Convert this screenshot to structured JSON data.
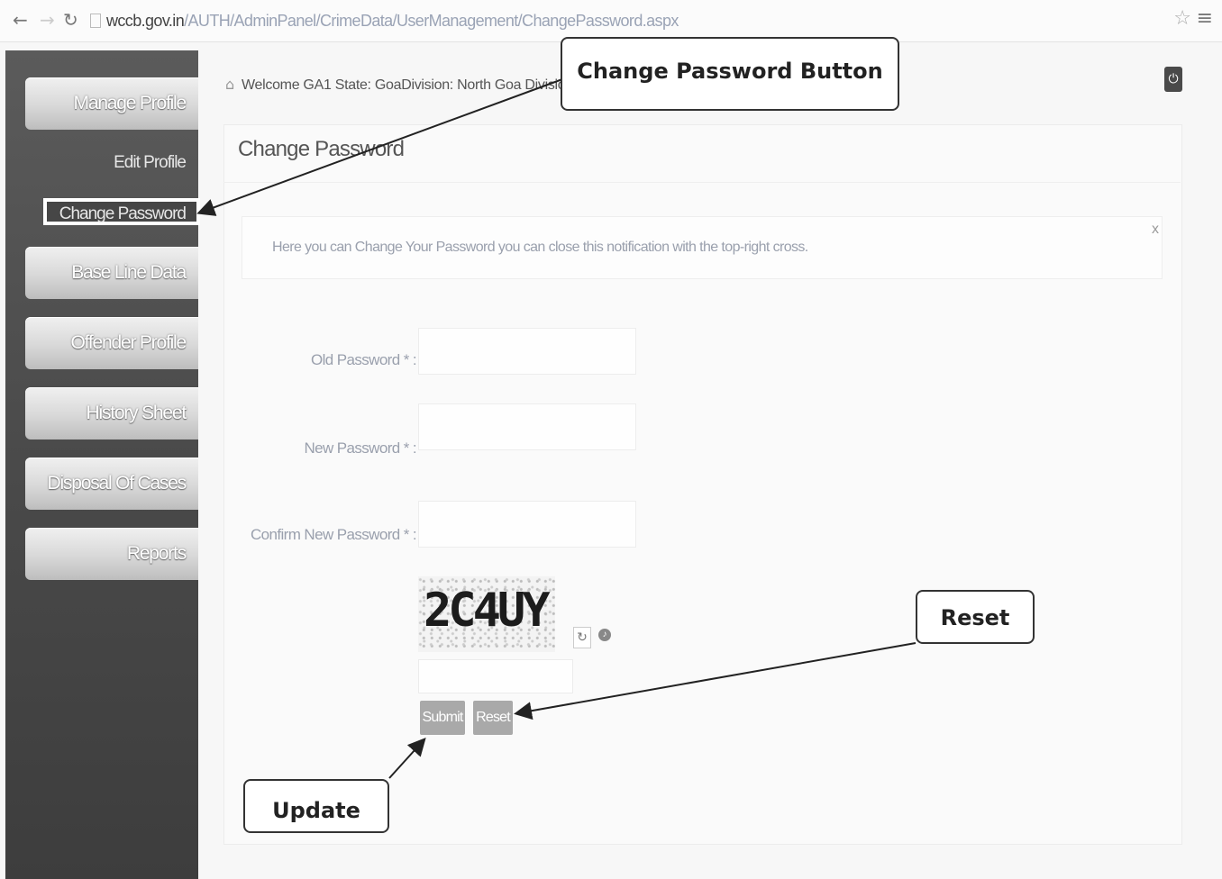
{
  "browser": {
    "back_icon": "arrow-left-icon",
    "forward_icon": "arrow-right-icon",
    "reload_icon": "reload-icon",
    "url_host": "wccb.gov.in",
    "url_path": "/AUTH/AdminPanel/CrimeData/UserManagement/ChangePassword.aspx"
  },
  "sidebar": {
    "manage_profile": "Manage Profile",
    "edit_profile": "Edit Profile",
    "change_password": "Change Password",
    "base_line_data": "Base Line Data",
    "offender_profile": "Offender Profile",
    "history_sheet": "History Sheet",
    "disposal_of_cases": "Disposal Of Cases",
    "reports": "Reports"
  },
  "header": {
    "welcome": "Welcome GA1 State: GoaDivision: North Goa Division"
  },
  "panel": {
    "title": "Change Password",
    "notice": "Here you can Change Your Password you can close this notification with the top-right cross.",
    "close_glyph": "x"
  },
  "form": {
    "old_password_label": "Old Password * :",
    "new_password_label": "New Password * :",
    "confirm_password_label": "Confirm New Password * :",
    "captcha_text": "2C4UY",
    "submit_label": "Submit",
    "reset_label": "Reset"
  },
  "callouts": {
    "change_password_button": "Change Password Button",
    "reset": "Reset",
    "update": "Update"
  },
  "colors": {
    "sidebar_bg": "#4a4a4a",
    "button_gray": "#a9a9a9",
    "url_path": "#9aa3b5"
  }
}
